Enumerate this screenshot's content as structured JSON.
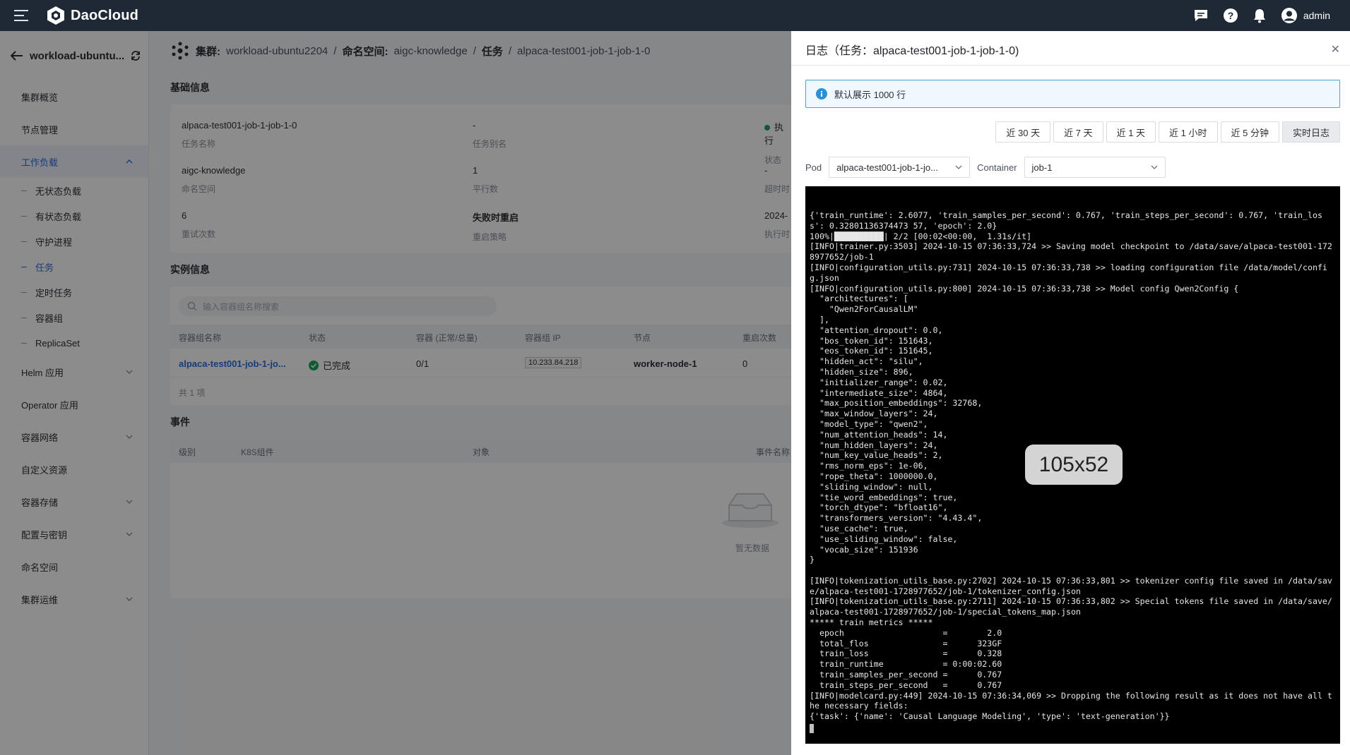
{
  "topbar": {
    "brand": "DaoCloud",
    "user": "admin",
    "icons": [
      "menu-icon",
      "daocloud-logo-icon",
      "message-icon",
      "help-icon",
      "bell-icon",
      "user-avatar-icon"
    ]
  },
  "sidebar": {
    "cluster_name": "workload-ubuntu...",
    "items": [
      {
        "label": "集群概览"
      },
      {
        "label": "节点管理"
      },
      {
        "label": "工作负载",
        "expanded": true
      },
      {
        "label": "Helm 应用"
      },
      {
        "label": "Operator 应用"
      },
      {
        "label": "容器网络"
      },
      {
        "label": "自定义资源"
      },
      {
        "label": "容器存储"
      },
      {
        "label": "配置与密钥"
      },
      {
        "label": "命名空间"
      },
      {
        "label": "集群运维"
      }
    ],
    "workload_sub": [
      "无状态负载",
      "有状态负载",
      "守护进程",
      "任务",
      "定时任务",
      "容器组",
      "ReplicaSet"
    ],
    "active_sub": "任务"
  },
  "breadcrumb": {
    "cluster_label": "集群:",
    "cluster": "workload-ubuntu2204",
    "namespace_label": "命名空间:",
    "namespace": "aigc-knowledge",
    "task_label": "任务",
    "job": "alpaca-test001-job-1-job-1-0",
    "sep": "/"
  },
  "basic_info": {
    "title": "基础信息",
    "fields": [
      {
        "value": "alpaca-test001-job-1-job-1-0",
        "key": "任务名称"
      },
      {
        "value": "-",
        "key": "任务别名"
      },
      {
        "value": "执行",
        "key": "状态"
      },
      {
        "value": "aigc-knowledge",
        "key": "命名空间"
      },
      {
        "value": "1",
        "key": "平行数"
      },
      {
        "value": "-",
        "key": "超时时"
      },
      {
        "value": "6",
        "key": "重试次数"
      },
      {
        "value": "失败时重启",
        "key": "重启策略"
      },
      {
        "value": "2024-",
        "key": "执行时"
      }
    ]
  },
  "instance_info": {
    "title": "实例信息",
    "search_placeholder": "输入容器组名称搜索",
    "headers": [
      "容器组名称",
      "状态",
      "容器 (正常/总量)",
      "容器组 IP",
      "节点",
      "重启次数"
    ],
    "row": {
      "name": "alpaca-test001-job-1-jo...",
      "status": "已完成",
      "containers": "0/1",
      "ip": "10.233.84.218",
      "node": "worker-node-1",
      "restarts": "0"
    },
    "total": "共 1 项"
  },
  "events": {
    "title": "事件",
    "headers": [
      "级别",
      "K8S组件",
      "对象",
      "事件名称"
    ],
    "empty": "暂无数据"
  },
  "drawer": {
    "title": "日志（任务：alpaca-test001-job-1-job-1-0)",
    "alert": "默认展示 1000 行",
    "time_buttons": [
      "近 30 天",
      "近 7 天",
      "近 1 天",
      "近 1 小时",
      "近 5 分钟",
      "实时日志"
    ],
    "active_time": "实时日志",
    "pod_label": "Pod",
    "pod_value": "alpaca-test001-job-1-jo...",
    "container_label": "Container",
    "container_value": "job-1",
    "log_text": "{'train_runtime': 2.6077, 'train_samples_per_second': 0.767, 'train_steps_per_second': 0.767, 'train_loss': 0.32801136374473 57, 'epoch': 2.0}\n100%|██████████| 2/2 [00:02<00:00,  1.31s/it]\n[INFO|trainer.py:3503] 2024-10-15 07:36:33,724 >> Saving model checkpoint to /data/save/alpaca-test001-1728977652/job-1\n[INFO|configuration_utils.py:731] 2024-10-15 07:36:33,738 >> loading configuration file /data/model/config.json\n[INFO|configuration_utils.py:800] 2024-10-15 07:36:33,738 >> Model config Qwen2Config {\n  \"architectures\": [\n    \"Qwen2ForCausalLM\"\n  ],\n  \"attention_dropout\": 0.0,\n  \"bos_token_id\": 151643,\n  \"eos_token_id\": 151645,\n  \"hidden_act\": \"silu\",\n  \"hidden_size\": 896,\n  \"initializer_range\": 0.02,\n  \"intermediate_size\": 4864,\n  \"max_position_embeddings\": 32768,\n  \"max_window_layers\": 24,\n  \"model_type\": \"qwen2\",\n  \"num_attention_heads\": 14,\n  \"num_hidden_layers\": 24,\n  \"num_key_value_heads\": 2,\n  \"rms_norm_eps\": 1e-06,\n  \"rope_theta\": 1000000.0,\n  \"sliding_window\": null,\n  \"tie_word_embeddings\": true,\n  \"torch_dtype\": \"bfloat16\",\n  \"transformers_version\": \"4.43.4\",\n  \"use_cache\": true,\n  \"use_sliding_window\": false,\n  \"vocab_size\": 151936\n}\n\n[INFO|tokenization_utils_base.py:2702] 2024-10-15 07:36:33,801 >> tokenizer config file saved in /data/save/alpaca-test001-1728977652/job-1/tokenizer_config.json\n[INFO|tokenization_utils_base.py:2711] 2024-10-15 07:36:33,802 >> Special tokens file saved in /data/save/alpaca-test001-1728977652/job-1/special_tokens_map.json\n***** train metrics *****\n  epoch                    =        2.0\n  total_flos               =      323GF\n  train_loss               =      0.328\n  train_runtime            = 0:00:02.60\n  train_samples_per_second =      0.767\n  train_steps_per_second   =      0.767\n[INFO|modelcard.py:449] 2024-10-15 07:36:34,069 >> Dropping the following result as it does not have all the necessary fields:\n{'task': {'name': 'Causal Language Modeling', 'type': 'text-generation'}}"
  },
  "size_tooltip": "105x52",
  "colors": {
    "topbar": "#1f2936",
    "accent": "#2d6cdf",
    "success": "#1aa35a",
    "alert_border": "#3fa7d6",
    "log_bg": "#000000"
  }
}
